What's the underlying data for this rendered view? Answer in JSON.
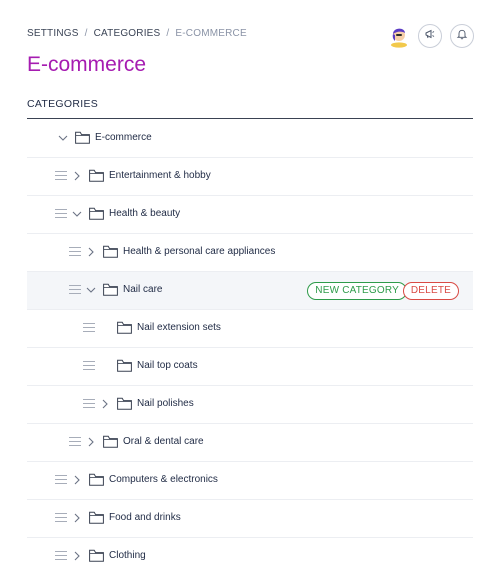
{
  "breadcrumb": {
    "items": [
      "SETTINGS",
      "CATEGORIES",
      "E-COMMERCE"
    ],
    "separator": "/"
  },
  "page_title": "E-commerce",
  "section_label": "CATEGORIES",
  "colors": {
    "title": "#a61cb1",
    "new_category": "#2e9b4a",
    "delete": "#d94a44"
  },
  "tree": {
    "rows": [
      {
        "label": "E-commerce",
        "depth": 0,
        "toggle": "chevron-down",
        "handle": false
      },
      {
        "label": "Entertainment & hobby",
        "depth": 1,
        "toggle": "chevron-right",
        "handle": true
      },
      {
        "label": "Health & beauty",
        "depth": 1,
        "toggle": "chevron-down",
        "handle": true
      },
      {
        "label": "Health & personal care appliances",
        "depth": 2,
        "toggle": "chevron-right",
        "handle": true
      },
      {
        "label": "Nail care",
        "depth": 2,
        "toggle": "chevron-down",
        "handle": true,
        "highlighted": true
      },
      {
        "label": "Nail extension sets",
        "depth": 3,
        "toggle": "none",
        "handle": true
      },
      {
        "label": "Nail top coats",
        "depth": 3,
        "toggle": "none",
        "handle": true
      },
      {
        "label": "Nail polishes",
        "depth": 3,
        "toggle": "chevron-right",
        "handle": true
      },
      {
        "label": "Oral & dental care",
        "depth": 2,
        "toggle": "chevron-right",
        "handle": true
      },
      {
        "label": "Computers & electronics",
        "depth": 1,
        "toggle": "chevron-right",
        "handle": true
      },
      {
        "label": "Food and drinks",
        "depth": 1,
        "toggle": "chevron-right",
        "handle": true
      },
      {
        "label": "Clothing",
        "depth": 1,
        "toggle": "chevron-right",
        "handle": true
      }
    ],
    "actions": {
      "new_category_label": "NEW CATEGORY",
      "delete_label": "DELETE"
    }
  },
  "icons": {
    "header": [
      "avatar",
      "megaphone-icon",
      "bell-icon"
    ],
    "row": [
      "drag-handle-icon",
      "chevron-icon",
      "folder-icon"
    ]
  }
}
